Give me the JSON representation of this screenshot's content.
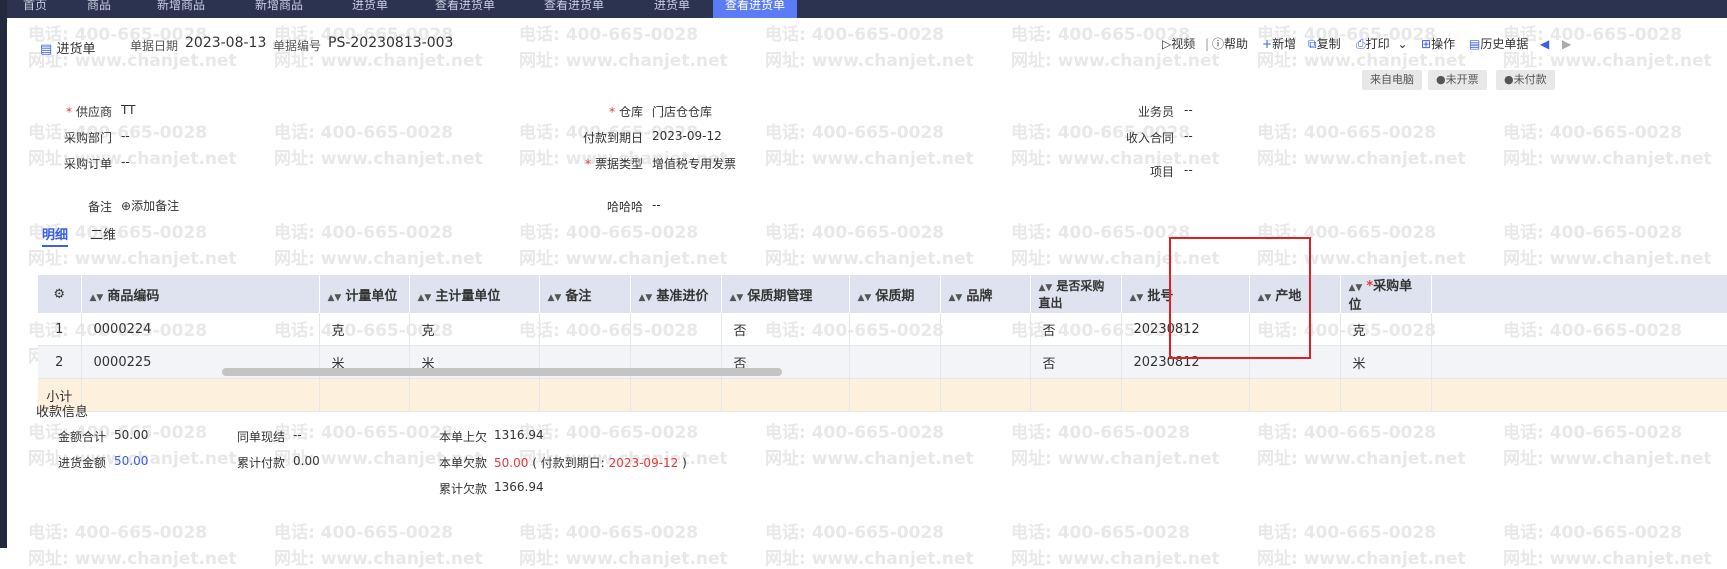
{
  "tabs": [
    "首页",
    "商品",
    "新增商品",
    "新增商品",
    "进货单",
    "查看进货单",
    "查看进货单",
    "进货单",
    "查看进货单"
  ],
  "header": {
    "title": "进货单",
    "date_label": "单据日期",
    "date_value": "2023-08-13",
    "code_label": "单据编号",
    "code_value": "PS-20230813-003"
  },
  "toolbar": {
    "video": "视频",
    "help": "帮助",
    "add": "新增",
    "copy": "复制",
    "print": "打印",
    "operate": "操作",
    "history": "历史单据"
  },
  "badges": [
    "来自电脑",
    "未开票",
    "未付款"
  ],
  "form": {
    "supplier_label": "供应商",
    "supplier_value": "TT",
    "dept_label": "采购部门",
    "dept_value": "--",
    "order_label": "采购订单",
    "order_value": "--",
    "warehouse_label": "仓库",
    "warehouse_value": "门店仓仓库",
    "due_label": "付款到期日",
    "due_value": "2023-09-12",
    "invoice_label": "票据类型",
    "invoice_value": "增值税专用发票",
    "salesman_label": "业务员",
    "salesman_value": "--",
    "contract_label": "收入合同",
    "contract_value": "--",
    "project_label": "项目",
    "project_value": "--",
    "note_label": "备注",
    "note_add": "添加备注",
    "hhh_label": "哈哈哈",
    "hhh_value": "--"
  },
  "subtabs": [
    "明细",
    "二维"
  ],
  "table": {
    "headers": [
      "商品编码",
      "计量单位",
      "主计量单位",
      "备注",
      "基准进价",
      "保质期管理",
      "保质期",
      "品牌",
      "是否采购直出",
      "批号",
      "产地",
      "采购单位"
    ],
    "rows": [
      {
        "idx": "1",
        "code": "0000224",
        "unit": "克",
        "main_unit": "克",
        "note": "",
        "price": "",
        "shelf_mgmt": "否",
        "shelf": "",
        "brand": "",
        "direct": "否",
        "batch": "20230812",
        "origin": "",
        "pur_unit": "克"
      },
      {
        "idx": "2",
        "code": "0000225",
        "unit": "米",
        "main_unit": "米",
        "note": "",
        "price": "",
        "shelf_mgmt": "否",
        "shelf": "",
        "brand": "",
        "direct": "否",
        "batch": "20230812",
        "origin": "",
        "pur_unit": "米"
      }
    ],
    "subtotal": "小计"
  },
  "payment": {
    "section_title": "收款信息",
    "total_label": "金额合计",
    "total_value": "50.00",
    "purchase_label": "进货金额",
    "purchase_value": "50.00",
    "settle_label": "同单现结",
    "settle_value": "--",
    "cum_paid_label": "累计付款",
    "cum_paid_value": "0.00",
    "prev_owe_label": "本单上欠",
    "prev_owe_value": "1316.94",
    "owe_label": "本单欠款",
    "owe_value": "50.00",
    "owe_due_prefix": "( 付款到期日:",
    "owe_due_value": "2023-09-12",
    "owe_due_suffix": ")",
    "cum_owe_label": "累计欠款",
    "cum_owe_value": "1366.94"
  },
  "watermark": {
    "phone": "电话: 400-665-0028",
    "site": "网址: www.chanjet.net"
  },
  "colors": {
    "accent": "#3a5ee8",
    "highlight_box": "#e02020",
    "subtotal_bg": "#fdf0dc",
    "header_bg": "#dfe3ef",
    "red_value": "#e23b3b"
  }
}
